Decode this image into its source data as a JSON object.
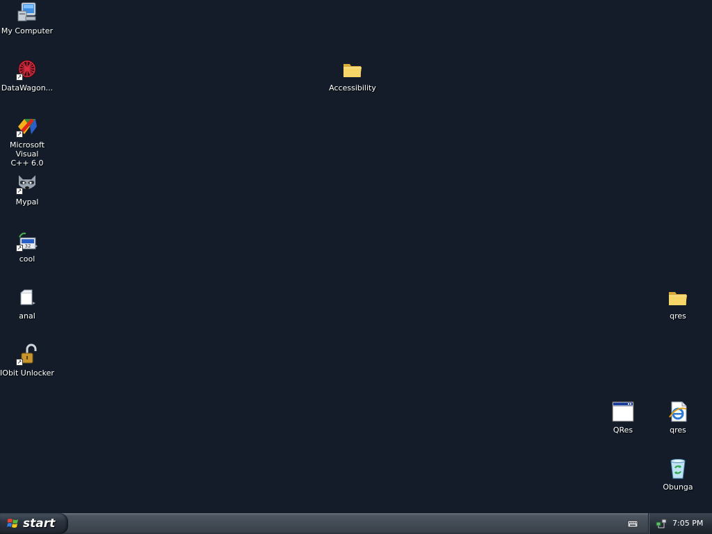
{
  "desktop": {
    "icons": [
      {
        "label": "My Computer",
        "icon": "my-computer-icon",
        "shortcut": false
      },
      {
        "label": "DataWagon...",
        "icon": "datawagon-icon",
        "shortcut": true
      },
      {
        "label": "Microsoft Visual\nC++ 6.0",
        "icon": "visual-cpp-icon",
        "shortcut": true
      },
      {
        "label": "Mypal",
        "icon": "mypal-raccoon-icon",
        "shortcut": true
      },
      {
        "label": "cool",
        "icon": "cool-shortcut-icon",
        "shortcut": true
      },
      {
        "label": "anal",
        "icon": "blank-file-icon",
        "shortcut": false
      },
      {
        "label": "IObit Unlocker",
        "icon": "iobit-unlocker-icon",
        "shortcut": true
      },
      {
        "label": "Accessibility",
        "icon": "folder-icon",
        "shortcut": false
      },
      {
        "label": "qres",
        "icon": "folder-icon",
        "shortcut": false
      },
      {
        "label": "QRes",
        "icon": "qres-window-icon",
        "shortcut": false
      },
      {
        "label": "qres",
        "icon": "internet-explorer-icon",
        "shortcut": false
      },
      {
        "label": "Obunga",
        "icon": "recycle-bin-icon",
        "shortcut": false
      }
    ]
  },
  "taskbar": {
    "start_label": "start",
    "clock": "7:05 PM"
  },
  "colors": {
    "desktop_background": "#131c28",
    "taskbar": "#434b55",
    "folder": "#f2cf5a"
  }
}
